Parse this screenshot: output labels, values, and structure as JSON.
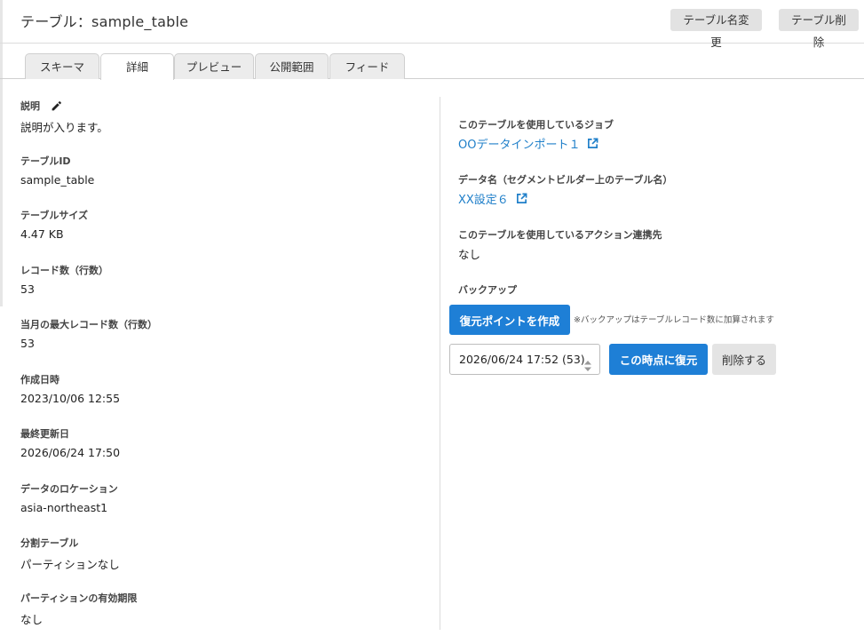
{
  "header": {
    "title": "テーブル：sample_table",
    "rename_label": "テーブル名変更",
    "delete_label": "テーブル削除"
  },
  "tabs": [
    {
      "label": "スキーマ",
      "active": false
    },
    {
      "label": "詳細",
      "active": true
    },
    {
      "label": "プレビュー",
      "active": false
    },
    {
      "label": "公開範囲",
      "active": false
    },
    {
      "label": "フィード",
      "active": false
    }
  ],
  "details": {
    "description": {
      "label": "説明",
      "value": "説明が入ります。",
      "icon": "pencil-icon"
    },
    "table_id": {
      "label": "テーブルID",
      "value": "sample_table"
    },
    "table_size": {
      "label": "テーブルサイズ",
      "value": "4.47 KB"
    },
    "record_count": {
      "label": "レコード数（行数）",
      "value": "53"
    },
    "max_records_month": {
      "label": "当月の最大レコード数（行数）",
      "value": "53"
    },
    "created_at": {
      "label": "作成日時",
      "value": "2023/10/06 12:55"
    },
    "updated_at": {
      "label": "最終更新日",
      "value": "2026/06/24 17:50"
    },
    "location": {
      "label": "データのロケーション",
      "value": "asia-northeast1"
    },
    "partition_table": {
      "label": "分割テーブル",
      "value": "パーティションなし"
    },
    "partition_expiry": {
      "label": "パーティションの有効期限",
      "value": "なし"
    }
  },
  "related": {
    "jobs": {
      "label": "このテーブルを使用しているジョブ",
      "link": "OOデータインポート１"
    },
    "data_name": {
      "label": "データ名（セグメントビルダー上のテーブル名）",
      "link": "XX設定６"
    },
    "actions": {
      "label": "このテーブルを使用しているアクション連携先",
      "value": "なし"
    }
  },
  "backup": {
    "label": "バックアップ",
    "create_label": "復元ポイントを作成",
    "note": "※バックアップはテーブルレコード数に加算されます",
    "selected": "2026/06/24 17:52 (53)",
    "restore_label": "この時点に復元",
    "delete_label": "削除する"
  },
  "colors": {
    "accent": "#1e7fd6",
    "link": "#1f7fc9",
    "secondary_button": "#e2e2e2"
  }
}
